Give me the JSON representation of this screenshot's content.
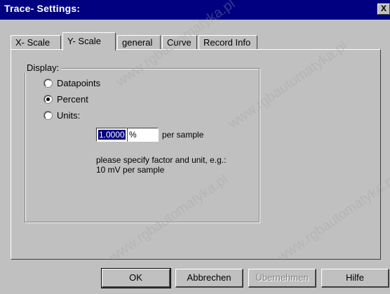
{
  "window": {
    "title": "Trace- Settings:",
    "close_label": "X"
  },
  "tabs": [
    {
      "label": "X- Scale",
      "active": false
    },
    {
      "label": "Y- Scale",
      "active": true
    },
    {
      "label": "general",
      "active": false
    },
    {
      "label": "Curve",
      "active": false
    },
    {
      "label": "Record Info",
      "active": false
    }
  ],
  "display": {
    "group_label": "Display:",
    "options": [
      {
        "label": "Datapoints",
        "checked": false
      },
      {
        "label": "Percent",
        "checked": true
      },
      {
        "label": "Units:",
        "checked": false
      }
    ],
    "factor_value": "1.0000",
    "unit_value": "%",
    "per_sample_label": "per sample",
    "hint_line1": "please specify factor and unit, e.g.:",
    "hint_line2": "10 mV per sample"
  },
  "buttons": {
    "ok": "OK",
    "cancel": "Abbrechen",
    "apply": "Übernehmen",
    "help": "Hilfe"
  },
  "watermark": "www.rgbautomatyka.pl"
}
